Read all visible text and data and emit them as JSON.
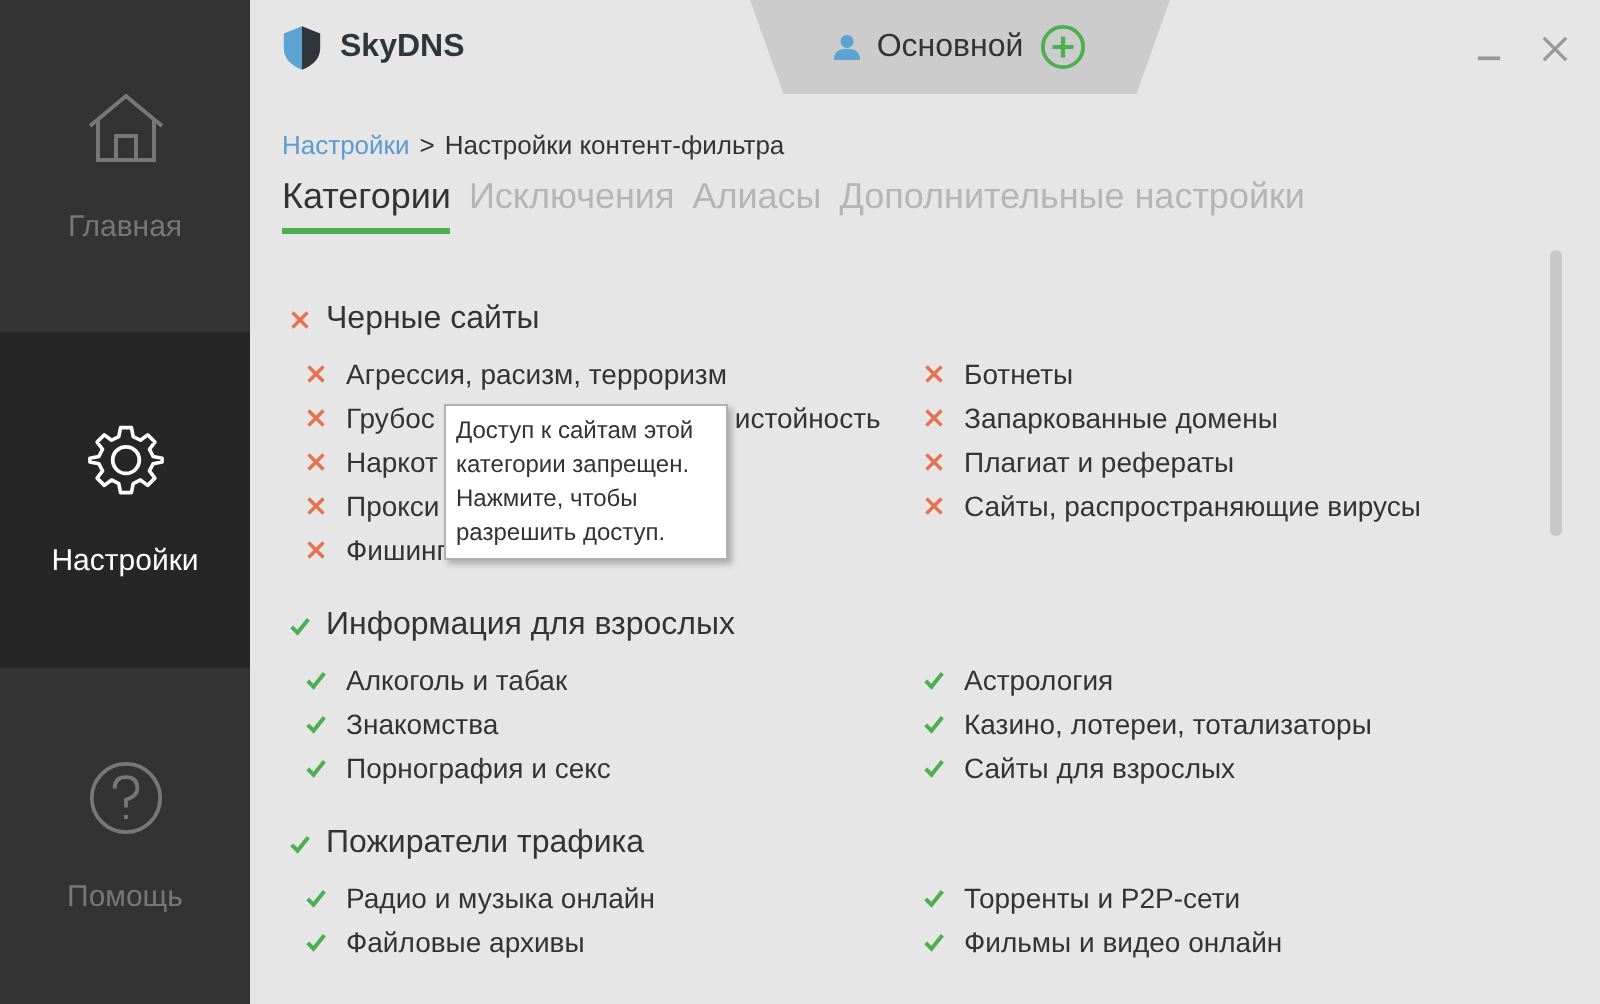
{
  "sidebar": {
    "items": [
      {
        "label": "Главная",
        "kind": "home",
        "selected": false
      },
      {
        "label": "Настройки",
        "kind": "settings",
        "selected": true
      },
      {
        "label": "Помощь",
        "kind": "help",
        "selected": false
      }
    ]
  },
  "header": {
    "app_name": "SkyDNS",
    "profile": "Основной"
  },
  "breadcrumb": {
    "link": "Настройки",
    "separator": ">",
    "current": "Настройки контент-фильтра"
  },
  "tabs": [
    {
      "label": "Категории",
      "selected": true
    },
    {
      "label": "Исключения",
      "selected": false
    },
    {
      "label": "Алиасы",
      "selected": false
    },
    {
      "label": "Дополнительные настройки",
      "selected": false
    }
  ],
  "groups": [
    {
      "title": "Черные сайты",
      "blocked": true,
      "columns": [
        [
          {
            "label": "Агрессия, расизм, терроризм",
            "blocked": true
          },
          {
            "label": "Грубос",
            "label_end": "истойность",
            "blocked": true
          },
          {
            "label": "Наркот",
            "blocked": true
          },
          {
            "label": "Прокси",
            "blocked": true
          },
          {
            "label": "Фишинг",
            "blocked": true
          }
        ],
        [
          {
            "label": "Ботнеты",
            "blocked": true
          },
          {
            "label": "Запаркованные домены",
            "blocked": true
          },
          {
            "label": "Плагиат и рефераты",
            "blocked": true
          },
          {
            "label": "Сайты, распространяющие вирусы",
            "blocked": true
          }
        ]
      ]
    },
    {
      "title": "Информация для взрослых",
      "blocked": false,
      "columns": [
        [
          {
            "label": "Алкоголь и табак",
            "blocked": false
          },
          {
            "label": "Знакомства",
            "blocked": false
          },
          {
            "label": "Порнография и секс",
            "blocked": false
          }
        ],
        [
          {
            "label": "Астрология",
            "blocked": false
          },
          {
            "label": "Казино, лотереи, тотализаторы",
            "blocked": false
          },
          {
            "label": "Сайты для взрослых",
            "blocked": false
          }
        ]
      ]
    },
    {
      "title": "Пожиратели трафика",
      "blocked": false,
      "columns": [
        [
          {
            "label": "Радио и музыка онлайн",
            "blocked": false
          },
          {
            "label": "Файловые архивы",
            "blocked": false
          }
        ],
        [
          {
            "label": "Торренты и P2P-сети",
            "blocked": false
          },
          {
            "label": "Фильмы и видео онлайн",
            "blocked": false
          }
        ]
      ]
    }
  ],
  "tooltip": {
    "lines": [
      "Доступ к сайтам этой",
      "категории запрещен.",
      "Нажмите, чтобы",
      "разрешить доступ."
    ]
  }
}
